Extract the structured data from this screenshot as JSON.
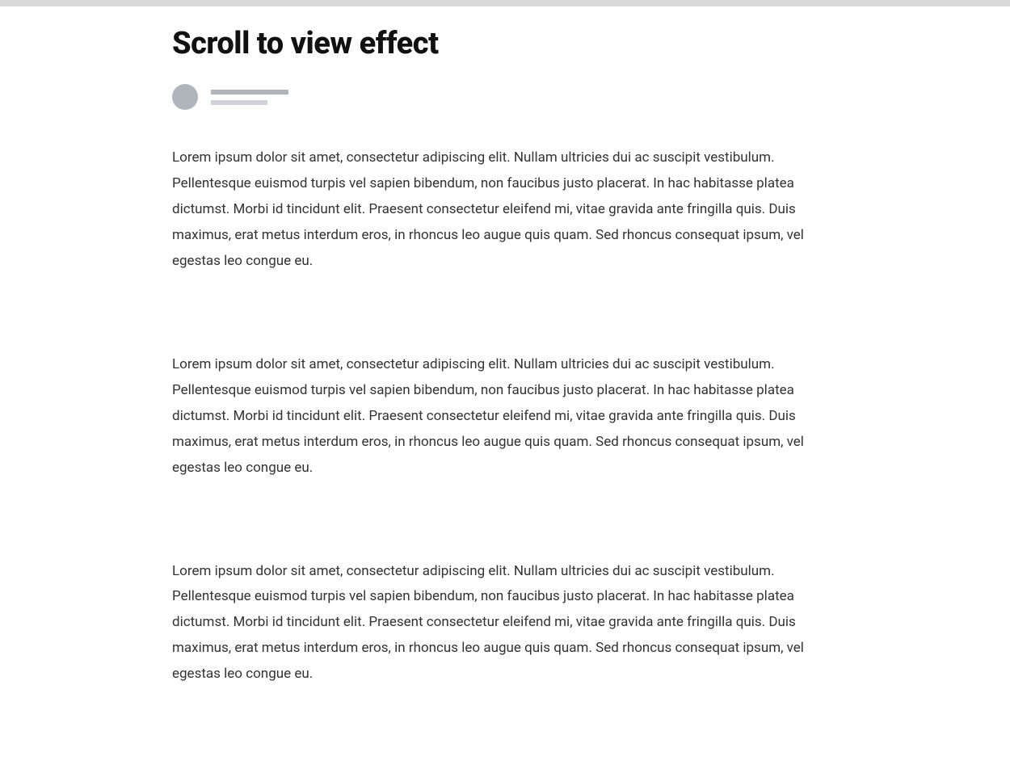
{
  "title": "Scroll to view effect",
  "paragraphs": [
    "Lorem ipsum dolor sit amet, consectetur adipiscing elit. Nullam ultricies dui ac suscipit vestibulum. Pellentesque euismod turpis vel sapien bibendum, non faucibus justo placerat. In hac habitasse platea dictumst. Morbi id tincidunt elit. Praesent consectetur eleifend mi, vitae gravida ante fringilla quis. Duis maximus, erat metus interdum eros, in rhoncus leo augue quis quam. Sed rhoncus consequat ipsum, vel egestas leo congue eu.",
    "Lorem ipsum dolor sit amet, consectetur adipiscing elit. Nullam ultricies dui ac suscipit vestibulum. Pellentesque euismod turpis vel sapien bibendum, non faucibus justo placerat. In hac habitasse platea dictumst. Morbi id tincidunt elit. Praesent consectetur eleifend mi, vitae gravida ante fringilla quis. Duis maximus, erat metus interdum eros, in rhoncus leo augue quis quam. Sed rhoncus consequat ipsum, vel egestas leo congue eu.",
    "Lorem ipsum dolor sit amet, consectetur adipiscing elit. Nullam ultricies dui ac suscipit vestibulum. Pellentesque euismod turpis vel sapien bibendum, non faucibus justo placerat. In hac habitasse platea dictumst. Morbi id tincidunt elit. Praesent consectetur eleifend mi, vitae gravida ante fringilla quis. Duis maximus, erat metus interdum eros, in rhoncus leo augue quis quam. Sed rhoncus consequat ipsum, vel egestas leo congue eu."
  ]
}
